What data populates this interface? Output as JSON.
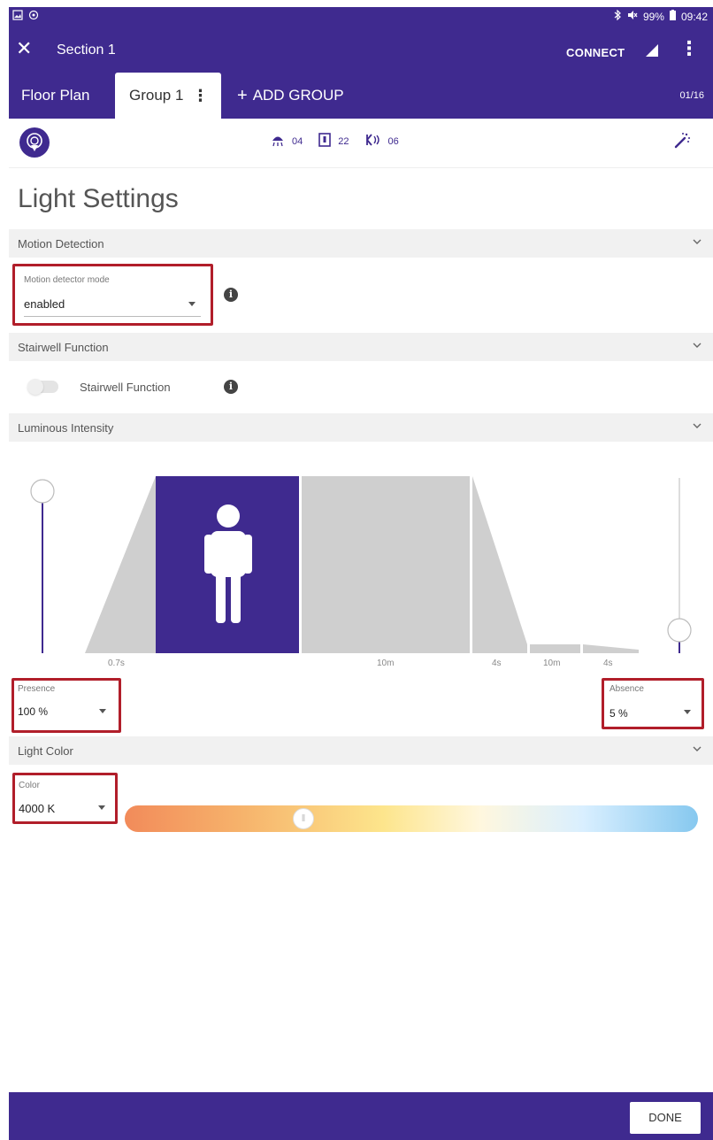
{
  "status_bar": {
    "battery": "99%",
    "time": "09:42"
  },
  "app_bar": {
    "title": "Section 1",
    "connect_label": "CONNECT"
  },
  "tabs": {
    "floor_plan": "Floor Plan",
    "group": "Group 1",
    "add_group": "ADD GROUP",
    "counter": "01/16"
  },
  "device_counts": {
    "luminaires": "04",
    "switches": "22",
    "sensors": "06"
  },
  "page_title": "Light Settings",
  "sections": {
    "motion": {
      "header": "Motion Detection",
      "field_label": "Motion detector mode",
      "field_value": "enabled"
    },
    "stairwell": {
      "header": "Stairwell Function",
      "toggle_label": "Stairwell Function",
      "toggle_on": false
    },
    "luminous": {
      "header": "Luminous Intensity",
      "timings": [
        "0.7s",
        "10m",
        "4s",
        "10m",
        "4s"
      ],
      "presence_label": "Presence",
      "presence_value": "100 %",
      "absence_label": "Absence",
      "absence_value": "5 %",
      "presence_level": 1.0,
      "absence_level": 0.05
    },
    "color": {
      "header": "Light Color",
      "field_label": "Color",
      "field_value": "4000 K",
      "slider_fraction": 0.31
    }
  },
  "footer": {
    "done_label": "DONE"
  },
  "colors": {
    "brand_purple": "#3f2a8f",
    "highlight_red": "#b11e2a"
  }
}
